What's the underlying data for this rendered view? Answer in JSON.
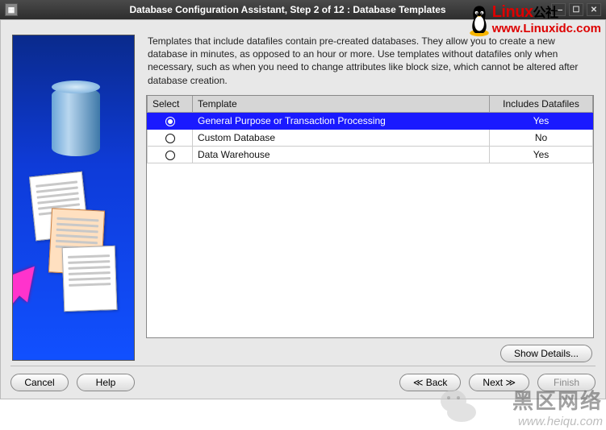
{
  "window": {
    "title": "Database Configuration Assistant, Step 2 of 12 : Database Templates"
  },
  "description": "Templates that include datafiles contain pre-created databases. They allow you to create a new database in minutes, as opposed to an hour or more. Use templates without datafiles only when necessary, such as when you need to change attributes like block size, which cannot be altered after database creation.",
  "table": {
    "columns": {
      "select": "Select",
      "template": "Template",
      "includes": "Includes Datafiles"
    },
    "rows": [
      {
        "selected": true,
        "template": "General Purpose or Transaction Processing",
        "includes": "Yes"
      },
      {
        "selected": false,
        "template": "Custom Database",
        "includes": "No"
      },
      {
        "selected": false,
        "template": "Data Warehouse",
        "includes": "Yes"
      }
    ]
  },
  "buttons": {
    "show_details": "Show Details...",
    "cancel": "Cancel",
    "help": "Help",
    "back": "Back",
    "next": "Next",
    "finish": "Finish"
  },
  "nav": {
    "back_icon": "≪",
    "next_icon": "≫"
  },
  "watermarks": {
    "top_brand": "Linux",
    "top_cn": "公社",
    "top_url": "www.Linuxidc.com",
    "bottom_cn": "黑区网络",
    "bottom_url": "www.heiqu.com"
  }
}
